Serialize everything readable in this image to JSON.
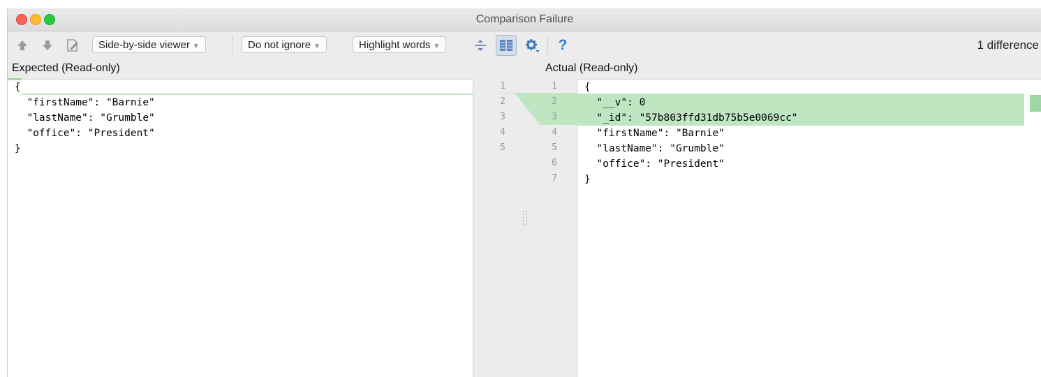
{
  "window": {
    "title": "Comparison Failure"
  },
  "toolbar": {
    "viewer_mode": "Side-by-side viewer",
    "ignore_mode": "Do not ignore",
    "highlight_mode": "Highlight words",
    "help_label": "?",
    "difference_count": "1 difference"
  },
  "icons": [
    "arrow-up-icon",
    "arrow-down-icon",
    "edit-source-icon",
    "collapse-unchanged-icon",
    "sync-scroll-icon",
    "settings-gear-icon",
    "help-icon"
  ],
  "left": {
    "header": "Expected (Read-only)",
    "line_numbers": [
      "1",
      "2",
      "3",
      "4",
      "5"
    ],
    "lines": [
      "{",
      "  \"firstName\": \"Barnie\"",
      "  \"lastName\": \"Grumble\"",
      "  \"office\": \"President\"",
      "}"
    ]
  },
  "right": {
    "header": "Actual (Read-only)",
    "line_numbers": [
      "1",
      "2",
      "3",
      "4",
      "5",
      "6",
      "7"
    ],
    "lines": [
      "{",
      "  \"__v\": 0",
      "  \"_id\": \"57b803ffd31db75b5e0069cc\"",
      "  \"firstName\": \"Barnie\"",
      "  \"lastName\": \"Grumble\"",
      "  \"office\": \"President\"",
      "}"
    ]
  },
  "colors": {
    "insert_highlight": "#bee6c0",
    "insert_marker": "#9fd6a2",
    "accent": "#2a7fd6"
  }
}
